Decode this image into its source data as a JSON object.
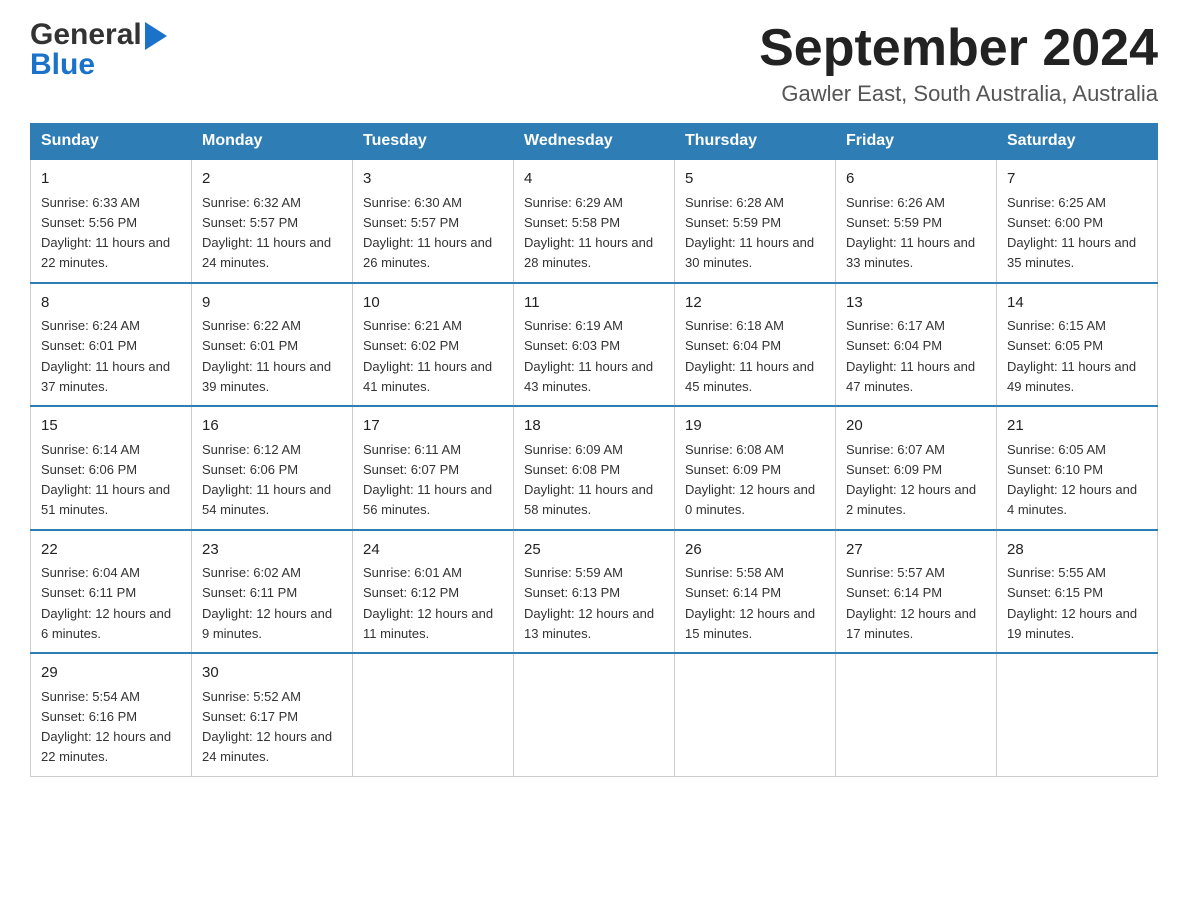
{
  "header": {
    "logo": {
      "general": "General",
      "blue": "Blue"
    },
    "title": "September 2024",
    "location": "Gawler East, South Australia, Australia"
  },
  "weekdays": [
    "Sunday",
    "Monday",
    "Tuesday",
    "Wednesday",
    "Thursday",
    "Friday",
    "Saturday"
  ],
  "weeks": [
    [
      {
        "day": "1",
        "sunrise": "6:33 AM",
        "sunset": "5:56 PM",
        "daylight": "11 hours and 22 minutes."
      },
      {
        "day": "2",
        "sunrise": "6:32 AM",
        "sunset": "5:57 PM",
        "daylight": "11 hours and 24 minutes."
      },
      {
        "day": "3",
        "sunrise": "6:30 AM",
        "sunset": "5:57 PM",
        "daylight": "11 hours and 26 minutes."
      },
      {
        "day": "4",
        "sunrise": "6:29 AM",
        "sunset": "5:58 PM",
        "daylight": "11 hours and 28 minutes."
      },
      {
        "day": "5",
        "sunrise": "6:28 AM",
        "sunset": "5:59 PM",
        "daylight": "11 hours and 30 minutes."
      },
      {
        "day": "6",
        "sunrise": "6:26 AM",
        "sunset": "5:59 PM",
        "daylight": "11 hours and 33 minutes."
      },
      {
        "day": "7",
        "sunrise": "6:25 AM",
        "sunset": "6:00 PM",
        "daylight": "11 hours and 35 minutes."
      }
    ],
    [
      {
        "day": "8",
        "sunrise": "6:24 AM",
        "sunset": "6:01 PM",
        "daylight": "11 hours and 37 minutes."
      },
      {
        "day": "9",
        "sunrise": "6:22 AM",
        "sunset": "6:01 PM",
        "daylight": "11 hours and 39 minutes."
      },
      {
        "day": "10",
        "sunrise": "6:21 AM",
        "sunset": "6:02 PM",
        "daylight": "11 hours and 41 minutes."
      },
      {
        "day": "11",
        "sunrise": "6:19 AM",
        "sunset": "6:03 PM",
        "daylight": "11 hours and 43 minutes."
      },
      {
        "day": "12",
        "sunrise": "6:18 AM",
        "sunset": "6:04 PM",
        "daylight": "11 hours and 45 minutes."
      },
      {
        "day": "13",
        "sunrise": "6:17 AM",
        "sunset": "6:04 PM",
        "daylight": "11 hours and 47 minutes."
      },
      {
        "day": "14",
        "sunrise": "6:15 AM",
        "sunset": "6:05 PM",
        "daylight": "11 hours and 49 minutes."
      }
    ],
    [
      {
        "day": "15",
        "sunrise": "6:14 AM",
        "sunset": "6:06 PM",
        "daylight": "11 hours and 51 minutes."
      },
      {
        "day": "16",
        "sunrise": "6:12 AM",
        "sunset": "6:06 PM",
        "daylight": "11 hours and 54 minutes."
      },
      {
        "day": "17",
        "sunrise": "6:11 AM",
        "sunset": "6:07 PM",
        "daylight": "11 hours and 56 minutes."
      },
      {
        "day": "18",
        "sunrise": "6:09 AM",
        "sunset": "6:08 PM",
        "daylight": "11 hours and 58 minutes."
      },
      {
        "day": "19",
        "sunrise": "6:08 AM",
        "sunset": "6:09 PM",
        "daylight": "12 hours and 0 minutes."
      },
      {
        "day": "20",
        "sunrise": "6:07 AM",
        "sunset": "6:09 PM",
        "daylight": "12 hours and 2 minutes."
      },
      {
        "day": "21",
        "sunrise": "6:05 AM",
        "sunset": "6:10 PM",
        "daylight": "12 hours and 4 minutes."
      }
    ],
    [
      {
        "day": "22",
        "sunrise": "6:04 AM",
        "sunset": "6:11 PM",
        "daylight": "12 hours and 6 minutes."
      },
      {
        "day": "23",
        "sunrise": "6:02 AM",
        "sunset": "6:11 PM",
        "daylight": "12 hours and 9 minutes."
      },
      {
        "day": "24",
        "sunrise": "6:01 AM",
        "sunset": "6:12 PM",
        "daylight": "12 hours and 11 minutes."
      },
      {
        "day": "25",
        "sunrise": "5:59 AM",
        "sunset": "6:13 PM",
        "daylight": "12 hours and 13 minutes."
      },
      {
        "day": "26",
        "sunrise": "5:58 AM",
        "sunset": "6:14 PM",
        "daylight": "12 hours and 15 minutes."
      },
      {
        "day": "27",
        "sunrise": "5:57 AM",
        "sunset": "6:14 PM",
        "daylight": "12 hours and 17 minutes."
      },
      {
        "day": "28",
        "sunrise": "5:55 AM",
        "sunset": "6:15 PM",
        "daylight": "12 hours and 19 minutes."
      }
    ],
    [
      {
        "day": "29",
        "sunrise": "5:54 AM",
        "sunset": "6:16 PM",
        "daylight": "12 hours and 22 minutes."
      },
      {
        "day": "30",
        "sunrise": "5:52 AM",
        "sunset": "6:17 PM",
        "daylight": "12 hours and 24 minutes."
      },
      null,
      null,
      null,
      null,
      null
    ]
  ]
}
